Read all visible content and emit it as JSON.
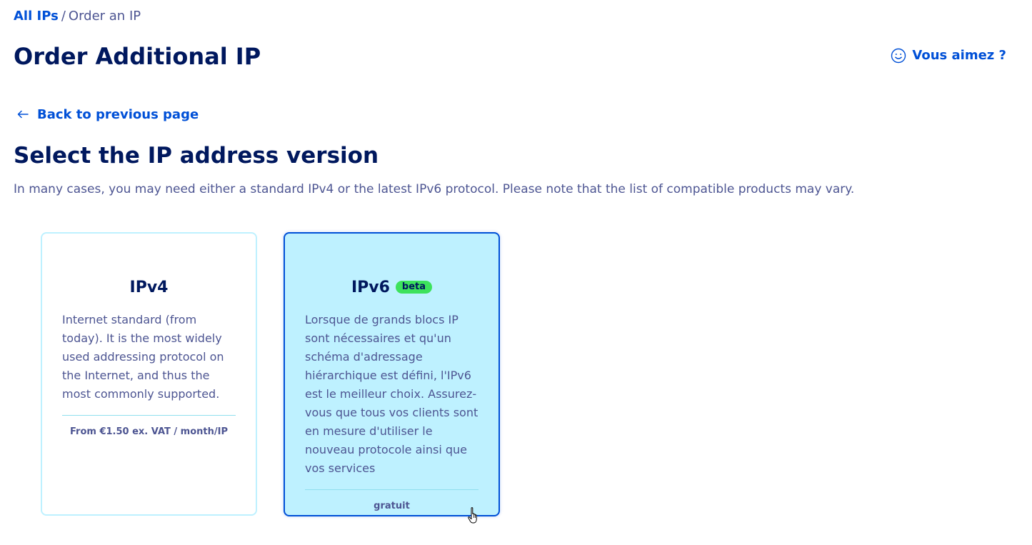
{
  "breadcrumb": {
    "parent": "All IPs",
    "separator": "/",
    "current": "Order an IP"
  },
  "page_title": "Order Additional IP",
  "feedback": {
    "icon": "smile-icon",
    "label": "Vous aimez ?"
  },
  "back_link": {
    "icon": "arrow-left-icon",
    "label": "Back to previous page"
  },
  "section": {
    "title": "Select the IP address version",
    "description": "In many cases, you may need either a standard IPv4 or the latest IPv6 protocol. Please note that the list of compatible products may vary."
  },
  "cards": [
    {
      "title": "IPv4",
      "description": "Internet standard (from today). It is the most widely used addressing protocol on the Internet, and thus the most commonly supported.",
      "price": "From €1.50 ex. VAT / month/IP",
      "selected": false
    },
    {
      "title": "IPv6",
      "badge": "beta",
      "description": "Lorsque de grands blocs IP sont nécessaires et qu'un schéma d'adressage hiérarchique est défini, l'IPv6 est le meilleur choix. Assurez-vous que tous vos clients sont en mesure d'utiliser le nouveau protocole ainsi que vos services",
      "price": "gratuit",
      "selected": true
    }
  ],
  "colors": {
    "primary_blue": "#0050d7",
    "heading": "#00185e",
    "text": "#4d5592",
    "card_border": "#bef1ff",
    "card_selected_bg": "#bef1ff",
    "badge_green": "#3de25c"
  }
}
